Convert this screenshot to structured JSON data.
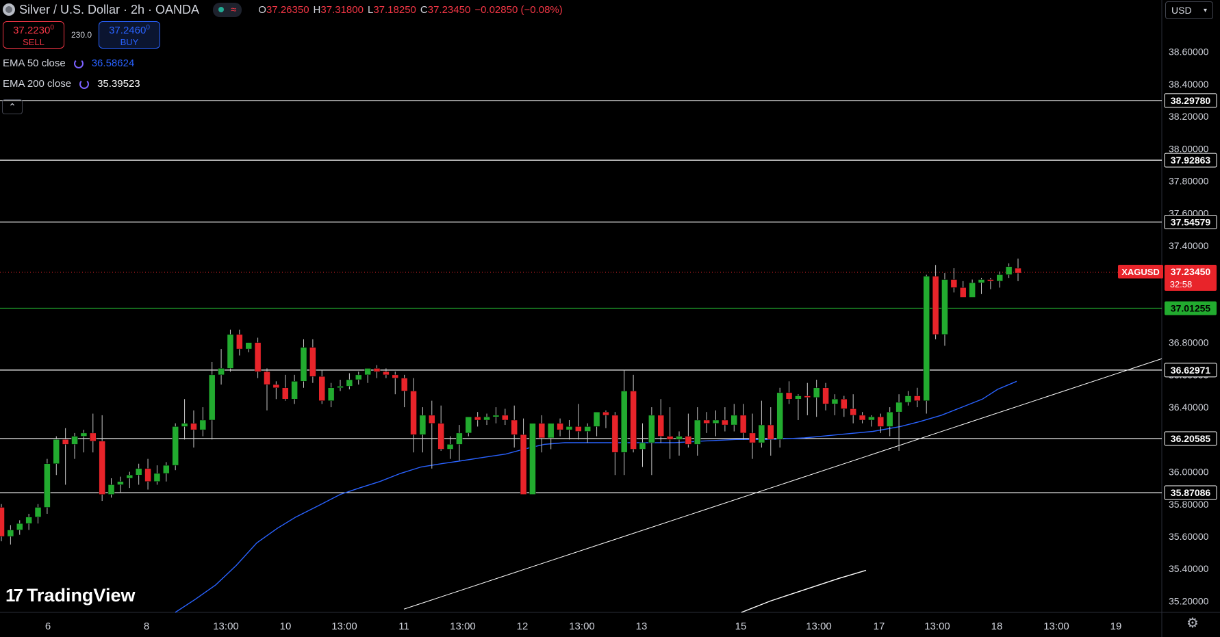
{
  "header": {
    "title": "Silver / U.S. Dollar · 2h · OANDA",
    "wave_icon": "≈",
    "ohlc": [
      {
        "key": "O",
        "value": "37.26350"
      },
      {
        "key": "H",
        "value": "37.31800"
      },
      {
        "key": "L",
        "value": "37.18250"
      },
      {
        "key": "C",
        "value": "37.23450"
      },
      {
        "key": "",
        "value": "−0.02850 (−0.08%)"
      }
    ]
  },
  "trade": {
    "sell_price": "37.2230",
    "sell_sup": "0",
    "sell_label": "SELL",
    "spread": "230.0",
    "buy_price": "37.2460",
    "buy_sup": "0",
    "buy_label": "BUY"
  },
  "indicators": [
    {
      "name": "EMA 50 close",
      "value": "36.58624",
      "color": "#2962ff"
    },
    {
      "name": "EMA 200 close",
      "value": "35.39523",
      "color": "#ffffff"
    }
  ],
  "currency": "USD",
  "collapse_icon": "⌃",
  "brand": "TradingView",
  "brand_mark": "17",
  "settings_icon": "⚙",
  "colors": {
    "up": "#22ab2f",
    "down": "#e8242a",
    "ema50": "#2962ff",
    "support_green": "#22ab2f",
    "price_tag": "#e8242a"
  },
  "chart_data": {
    "type": "candlestick",
    "symbol": "XAGUSD",
    "y_range": [
      35.13,
      38.92
    ],
    "y_ticks": [
      "38.60000",
      "38.40000",
      "38.20000",
      "38.00000",
      "37.80000",
      "37.60000",
      "37.40000",
      "36.80000",
      "36.60000",
      "36.40000",
      "36.20000",
      "36.00000",
      "35.80000",
      "35.60000",
      "35.40000",
      "35.20000"
    ],
    "x_labels": [
      "6",
      "8",
      "13:00",
      "10",
      "13:00",
      "11",
      "13:00",
      "12",
      "13:00",
      "13",
      "15",
      "13:00",
      "17",
      "13:00",
      "18",
      "13:00",
      "19"
    ],
    "horizontal_levels": [
      {
        "value": 38.2978,
        "label": "38.29780",
        "color": "#ffffff"
      },
      {
        "value": 37.92863,
        "label": "37.92863",
        "color": "#ffffff"
      },
      {
        "value": 37.54579,
        "label": "37.54579",
        "color": "#ffffff"
      },
      {
        "value": 37.01255,
        "label": "37.01255",
        "color": "#22ab2f"
      },
      {
        "value": 36.62971,
        "label": "36.62971",
        "color": "#ffffff"
      },
      {
        "value": 36.20585,
        "label": "36.20585",
        "color": "#ffffff"
      },
      {
        "value": 35.87086,
        "label": "35.87086",
        "color": "#ffffff"
      }
    ],
    "last_price": {
      "value": 37.2345,
      "label": "37.23450",
      "countdown": "32:58"
    },
    "candles": [
      [
        35.78,
        35.8,
        35.57,
        35.6
      ],
      [
        35.6,
        35.67,
        35.55,
        35.64
      ],
      [
        35.64,
        35.7,
        35.61,
        35.68
      ],
      [
        35.68,
        35.74,
        35.64,
        35.72
      ],
      [
        35.72,
        35.8,
        35.68,
        35.78
      ],
      [
        35.78,
        36.08,
        35.74,
        36.05
      ],
      [
        36.05,
        36.22,
        35.98,
        36.2
      ],
      [
        36.2,
        36.27,
        35.92,
        36.17
      ],
      [
        36.17,
        36.24,
        36.08,
        36.22
      ],
      [
        36.22,
        36.26,
        36.12,
        36.24
      ],
      [
        36.24,
        36.36,
        36.12,
        36.19
      ],
      [
        36.19,
        36.35,
        35.82,
        35.86
      ],
      [
        35.86,
        35.96,
        35.84,
        35.92
      ],
      [
        35.92,
        35.97,
        35.87,
        35.94
      ],
      [
        35.96,
        36.0,
        35.9,
        35.98
      ],
      [
        35.98,
        36.05,
        35.92,
        36.02
      ],
      [
        36.02,
        36.08,
        35.89,
        35.94
      ],
      [
        35.94,
        36.04,
        35.92,
        35.99
      ],
      [
        35.99,
        36.06,
        35.94,
        36.04
      ],
      [
        36.04,
        36.3,
        36.01,
        36.28
      ],
      [
        36.28,
        36.45,
        36.2,
        36.3
      ],
      [
        36.3,
        36.38,
        36.15,
        36.26
      ],
      [
        36.26,
        36.4,
        36.22,
        36.32
      ],
      [
        36.32,
        36.68,
        36.2,
        36.6
      ],
      [
        36.6,
        36.76,
        36.54,
        36.64
      ],
      [
        36.64,
        36.88,
        36.62,
        36.85
      ],
      [
        36.85,
        36.88,
        36.72,
        36.76
      ],
      [
        36.76,
        36.8,
        36.74,
        36.8
      ],
      [
        36.8,
        36.83,
        36.58,
        36.62
      ],
      [
        36.62,
        36.64,
        36.38,
        36.54
      ],
      [
        36.54,
        36.56,
        36.45,
        36.52
      ],
      [
        36.52,
        36.6,
        36.44,
        36.45
      ],
      [
        36.45,
        36.6,
        36.42,
        36.56
      ],
      [
        36.56,
        36.82,
        36.52,
        36.77
      ],
      [
        36.77,
        36.82,
        36.55,
        36.59
      ],
      [
        36.59,
        36.63,
        36.42,
        36.44
      ],
      [
        36.44,
        36.55,
        36.4,
        36.52
      ],
      [
        36.52,
        36.57,
        36.5,
        36.53
      ],
      [
        36.53,
        36.61,
        36.51,
        36.57
      ],
      [
        36.57,
        36.62,
        36.54,
        36.6
      ],
      [
        36.6,
        36.64,
        36.55,
        36.64
      ],
      [
        36.64,
        36.66,
        36.58,
        36.62
      ],
      [
        36.62,
        36.64,
        36.58,
        36.6
      ],
      [
        36.6,
        36.62,
        36.48,
        36.58
      ],
      [
        36.58,
        36.6,
        36.4,
        36.5
      ],
      [
        36.5,
        36.58,
        36.12,
        36.23
      ],
      [
        36.23,
        36.4,
        36.12,
        36.35
      ],
      [
        36.35,
        36.44,
        36.02,
        36.3
      ],
      [
        36.3,
        36.41,
        36.13,
        36.14
      ],
      [
        36.14,
        36.22,
        36.08,
        36.17
      ],
      [
        36.17,
        36.29,
        36.07,
        36.24
      ],
      [
        36.24,
        36.34,
        36.22,
        36.34
      ],
      [
        36.34,
        36.37,
        36.28,
        36.32
      ],
      [
        36.32,
        36.36,
        36.29,
        36.34
      ],
      [
        36.34,
        36.4,
        36.3,
        36.35
      ],
      [
        36.35,
        36.39,
        36.29,
        36.32
      ],
      [
        36.32,
        36.41,
        36.15,
        36.23
      ],
      [
        36.23,
        36.33,
        35.86,
        35.86
      ],
      [
        35.86,
        36.3,
        35.86,
        36.3
      ],
      [
        36.3,
        36.35,
        36.12,
        36.21
      ],
      [
        36.21,
        36.3,
        36.14,
        36.3
      ],
      [
        36.3,
        36.33,
        36.22,
        36.26
      ],
      [
        36.26,
        36.32,
        36.2,
        36.28
      ],
      [
        36.28,
        36.42,
        36.2,
        36.25
      ],
      [
        36.25,
        36.3,
        36.18,
        36.28
      ],
      [
        36.28,
        36.37,
        36.22,
        36.37
      ],
      [
        36.37,
        36.38,
        36.27,
        36.35
      ],
      [
        36.35,
        36.37,
        35.98,
        36.12
      ],
      [
        36.12,
        36.63,
        35.98,
        36.5
      ],
      [
        36.5,
        36.6,
        36.12,
        36.14
      ],
      [
        36.14,
        36.3,
        36.03,
        36.18
      ],
      [
        36.18,
        36.4,
        35.98,
        36.35
      ],
      [
        36.35,
        36.45,
        36.18,
        36.22
      ],
      [
        36.22,
        36.4,
        36.08,
        36.2
      ],
      [
        36.2,
        36.25,
        36.1,
        36.22
      ],
      [
        36.22,
        36.36,
        36.15,
        36.17
      ],
      [
        36.17,
        36.4,
        36.1,
        36.32
      ],
      [
        36.32,
        36.37,
        36.24,
        36.3
      ],
      [
        36.3,
        36.38,
        36.22,
        36.32
      ],
      [
        36.32,
        36.4,
        36.25,
        36.29
      ],
      [
        36.29,
        36.42,
        36.25,
        36.35
      ],
      [
        36.35,
        36.42,
        36.2,
        36.24
      ],
      [
        36.24,
        36.36,
        36.08,
        36.18
      ],
      [
        36.18,
        36.44,
        36.15,
        36.29
      ],
      [
        36.29,
        36.4,
        36.1,
        36.2
      ],
      [
        36.2,
        36.52,
        36.15,
        36.49
      ],
      [
        36.49,
        36.56,
        36.42,
        36.45
      ],
      [
        36.45,
        36.48,
        36.32,
        36.47
      ],
      [
        36.47,
        36.55,
        36.35,
        36.46
      ],
      [
        36.46,
        36.57,
        36.34,
        36.52
      ],
      [
        36.52,
        36.55,
        36.38,
        36.42
      ],
      [
        36.42,
        36.48,
        36.35,
        36.45
      ],
      [
        36.45,
        36.47,
        36.34,
        36.39
      ],
      [
        36.39,
        36.48,
        36.3,
        36.35
      ],
      [
        36.35,
        36.37,
        36.3,
        36.32
      ],
      [
        36.32,
        36.35,
        36.28,
        36.34
      ],
      [
        36.34,
        36.36,
        36.24,
        36.28
      ],
      [
        36.28,
        36.4,
        36.22,
        36.37
      ],
      [
        36.37,
        36.48,
        36.13,
        36.43
      ],
      [
        36.43,
        36.5,
        36.41,
        36.47
      ],
      [
        36.47,
        36.52,
        36.4,
        36.44
      ],
      [
        36.44,
        37.22,
        36.36,
        37.21
      ],
      [
        37.21,
        37.28,
        36.82,
        36.85
      ],
      [
        36.85,
        37.23,
        36.78,
        37.19
      ],
      [
        37.19,
        37.26,
        37.11,
        37.14
      ],
      [
        37.14,
        37.18,
        37.08,
        37.08
      ],
      [
        37.08,
        37.19,
        37.08,
        37.17
      ],
      [
        37.17,
        37.2,
        37.1,
        37.19
      ],
      [
        37.19,
        37.2,
        37.13,
        37.18
      ],
      [
        37.18,
        37.24,
        37.14,
        37.22
      ],
      [
        37.22,
        37.29,
        37.2,
        37.27
      ],
      [
        37.26,
        37.32,
        37.18,
        37.23
      ]
    ],
    "ema50": [
      [
        31,
        35.13
      ],
      [
        60,
        35.21
      ],
      [
        90,
        35.3
      ],
      [
        120,
        35.42
      ],
      [
        150,
        35.56
      ],
      [
        180,
        35.65
      ],
      [
        207,
        35.72
      ],
      [
        240,
        35.79
      ],
      [
        272,
        35.86
      ],
      [
        300,
        35.9
      ],
      [
        330,
        35.94
      ],
      [
        360,
        35.99
      ],
      [
        390,
        36.03
      ],
      [
        420,
        36.05
      ],
      [
        452,
        36.07
      ],
      [
        482,
        36.09
      ],
      [
        514,
        36.11
      ],
      [
        540,
        36.14
      ],
      [
        570,
        36.17
      ],
      [
        600,
        36.18
      ],
      [
        642,
        36.18
      ],
      [
        700,
        36.18
      ],
      [
        760,
        36.18
      ],
      [
        800,
        36.19
      ],
      [
        850,
        36.2
      ],
      [
        900,
        36.2
      ],
      [
        950,
        36.21
      ],
      [
        1000,
        36.23
      ],
      [
        1050,
        36.25
      ],
      [
        1090,
        36.28
      ],
      [
        1118,
        36.31
      ],
      [
        1150,
        36.35
      ],
      [
        1180,
        36.4
      ],
      [
        1210,
        36.45
      ],
      [
        1232,
        36.51
      ],
      [
        1260,
        36.56
      ]
    ],
    "ema200": [
      [
        858,
        35.13
      ],
      [
        900,
        35.2
      ],
      [
        950,
        35.27
      ],
      [
        1000,
        35.34
      ],
      [
        1040,
        35.39
      ]
    ],
    "trendline": [
      [
        18,
        35.15
      ],
      [
        1220,
        36.7
      ]
    ]
  }
}
